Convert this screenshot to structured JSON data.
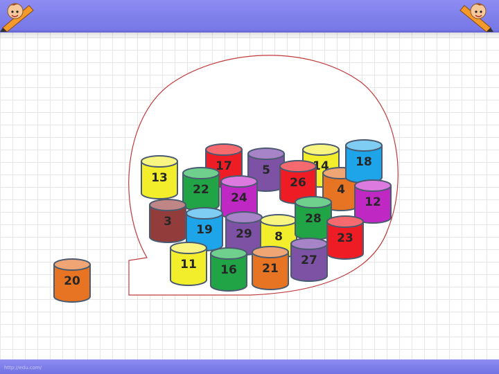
{
  "footer": {
    "url": "http://edu.com/"
  },
  "loose_can": {
    "number": "20",
    "color": "#e77422",
    "top": "#f0a574"
  },
  "cans": [
    {
      "number": "17",
      "color": "#ee1c24",
      "top": "#f46a6f"
    },
    {
      "number": "5",
      "color": "#7d51a3",
      "top": "#a783c8"
    },
    {
      "number": "14",
      "color": "#f2ee2c",
      "top": "#f8f583"
    },
    {
      "number": "13",
      "color": "#f2ee2c",
      "top": "#f8f583"
    },
    {
      "number": "22",
      "color": "#20a446",
      "top": "#6fcf8d"
    },
    {
      "number": "24",
      "color": "#c028c4",
      "top": "#dc7ae0"
    },
    {
      "number": "26",
      "color": "#ee1c24",
      "top": "#f46a6f"
    },
    {
      "number": "4",
      "color": "#e77422",
      "top": "#f0a574"
    },
    {
      "number": "18",
      "color": "#1ea4e8",
      "top": "#7fcdf2"
    },
    {
      "number": "12",
      "color": "#c028c4",
      "top": "#dc7ae0"
    },
    {
      "number": "3",
      "color": "#933c3c",
      "top": "#c08585"
    },
    {
      "number": "19",
      "color": "#1ea4e8",
      "top": "#7fcdf2"
    },
    {
      "number": "29",
      "color": "#7d51a3",
      "top": "#a783c8"
    },
    {
      "number": "8",
      "color": "#f2ee2c",
      "top": "#f8f583"
    },
    {
      "number": "28",
      "color": "#20a446",
      "top": "#6fcf8d"
    },
    {
      "number": "23",
      "color": "#ee1c24",
      "top": "#f46a6f"
    },
    {
      "number": "11",
      "color": "#f2ee2c",
      "top": "#f8f583"
    },
    {
      "number": "16",
      "color": "#20a446",
      "top": "#6fcf8d"
    },
    {
      "number": "21",
      "color": "#e77422",
      "top": "#f0a574"
    },
    {
      "number": "27",
      "color": "#7d51a3",
      "top": "#a783c8"
    }
  ],
  "bag_outline_color": "#c0393b"
}
